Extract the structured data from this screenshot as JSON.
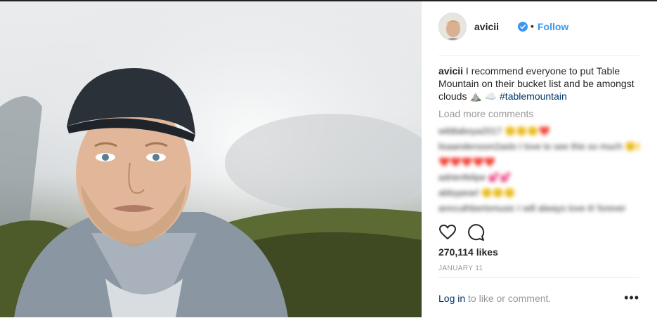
{
  "post": {
    "username": "avicii",
    "follow_label": "Follow",
    "separator": "•",
    "caption": {
      "username": "avicii",
      "text": "I recommend everyone to put Table Mountain on their bucket list and be amongst clouds ⛰️ ☁️",
      "hashtag": "#tablemountain"
    },
    "load_more_label": "Load more comments",
    "comments": [
      {
        "text": "wildtaboya2017 🙂🙂🙂❤️"
      },
      {
        "text": "lisaandersson2aslo I love to see this so much 🙂🙂🙂"
      },
      {
        "text": "❤️❤️❤️❤️❤️"
      },
      {
        "text": "adrienfelipe 💕💕"
      },
      {
        "text": "abbypearl 🙂🙂🙂"
      },
      {
        "text": "anncuthbertsmusic I will always love it! forever"
      }
    ],
    "likes_label": "270,114 likes",
    "date_label": "JANUARY 11",
    "login_link": "Log in",
    "login_suffix": " to like or comment.",
    "more_label": "•••"
  },
  "colors": {
    "accent": "#3897f0",
    "hashtag": "#003569",
    "muted": "#999999",
    "text": "#262626",
    "verified": "#3897f0"
  },
  "icons": [
    "verified-badge-icon",
    "heart-icon",
    "comment-icon",
    "more-options-icon"
  ]
}
